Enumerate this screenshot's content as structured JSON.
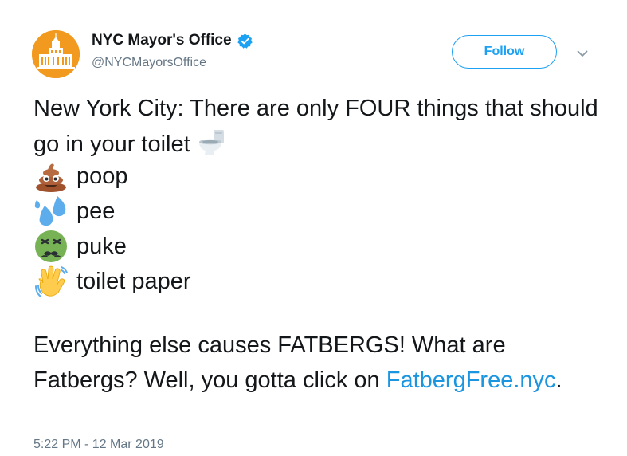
{
  "account": {
    "display_name": "NYC Mayor's Office",
    "handle": "@NYCMayorsOffice",
    "verified_icon": "verified-badge-icon",
    "avatar_icon": "city-hall-icon"
  },
  "actions": {
    "follow_label": "Follow",
    "more_icon": "chevron-down-icon"
  },
  "tweet": {
    "intro_text": "New York City: There are only FOUR things that should go in your toilet",
    "intro_icon": "toilet-icon",
    "items": [
      {
        "icon": "poop-icon",
        "label": "poop"
      },
      {
        "icon": "droplets-icon",
        "label": "pee"
      },
      {
        "icon": "nauseated-face-icon",
        "label": "puke"
      },
      {
        "icon": "waving-hand-icon",
        "label": "toilet paper"
      }
    ],
    "outro_text": "Everything else causes FATBERGS! What are Fatbergs? Well, you gotta click on",
    "link_text": "FatbergFree.nyc",
    "link_suffix": "."
  },
  "timestamp": "5:22 PM - 12 Mar 2019",
  "colors": {
    "accent": "#1da1f2",
    "link": "#1b95e0",
    "muted": "#657786",
    "avatar_bg": "#f29a1f"
  }
}
